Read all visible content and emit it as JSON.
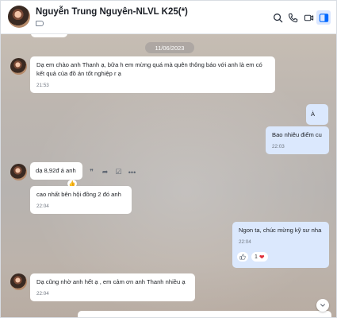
{
  "header": {
    "title": "Nguyễn Trung Nguyên-NLVL K25(*)",
    "buttons": [
      "search-icon",
      "phone-icon",
      "video-icon",
      "sidebar-toggle-icon"
    ]
  },
  "chat": {
    "date_divider": "11/06/2023",
    "messages": [
      {
        "direction": "in",
        "text": "Dạ em chào anh Thanh ạ, bữa h em mừng quá mà quên thông báo với anh là em có kết quả của đồ án tốt nghiệp r ạ",
        "time": "21:53"
      },
      {
        "direction": "out",
        "text": "À",
        "time": ""
      },
      {
        "direction": "out",
        "text": "Bao nhiêu điểm cu",
        "time": "22:03"
      },
      {
        "direction": "in",
        "text": "dạ 8,92đ á anh",
        "time": ""
      },
      {
        "direction": "in",
        "text": "cao nhất bên hội đồng 2 đó anh",
        "time": "22:04"
      },
      {
        "direction": "out",
        "text": "Ngon ta, chúc mừng kỹ sư nha",
        "time": "22:04"
      },
      {
        "direction": "in",
        "text": "Dạ cũng nhờ anh hết ạ , em cảm ơn anh Thanh nhiều ạ",
        "time": "22:04"
      }
    ],
    "reactions": {
      "heart_count": "1"
    },
    "hover_actions": [
      "quote-icon",
      "forward-icon",
      "task-icon",
      "more-icon"
    ]
  },
  "colors": {
    "accent": "#0068ff",
    "out_bubble": "#dbe8fd",
    "in_bubble": "#ffffff"
  }
}
